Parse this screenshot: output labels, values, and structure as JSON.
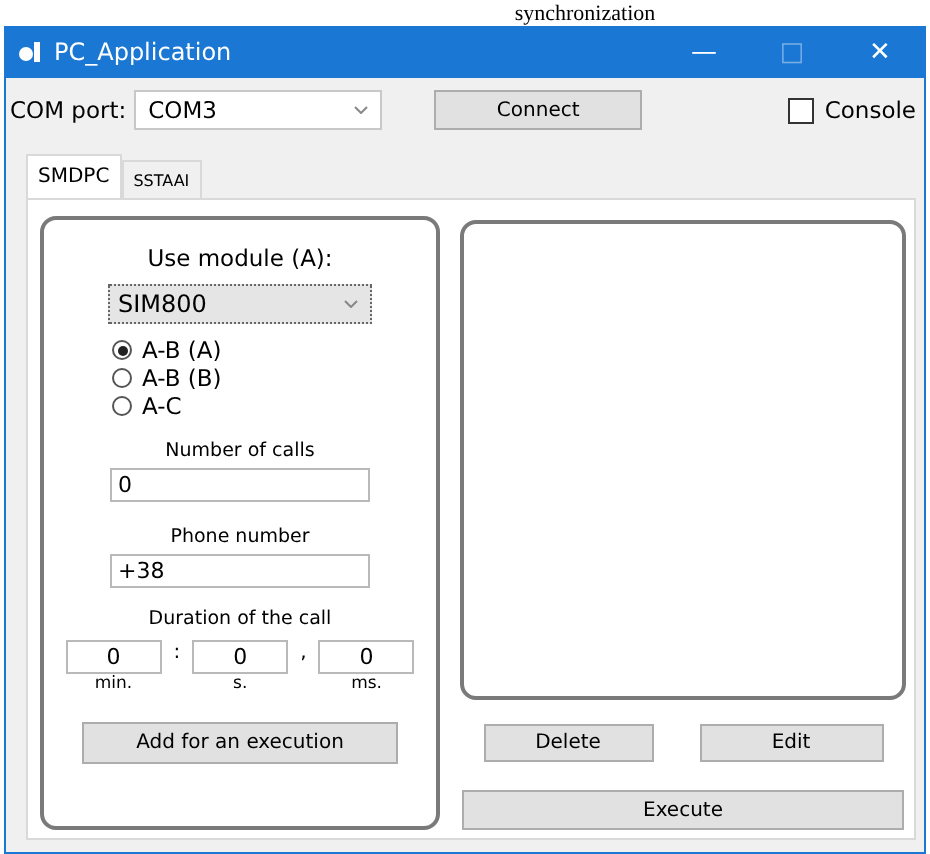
{
  "page_heading": "synchronization",
  "window": {
    "title": "PC_Application",
    "controls": [
      "—",
      "□",
      "✕"
    ]
  },
  "toolbar": {
    "port_label": "COM port:",
    "port_value": "COM3",
    "connect": "Connect",
    "console": {
      "label": "Console",
      "checked": false
    }
  },
  "tabs": [
    {
      "label": "SMDPC",
      "selected": true
    },
    {
      "label": "SSTAAI",
      "selected": false
    }
  ],
  "form": {
    "module_label": "Use module (A):",
    "module_value": "SIM800",
    "routes": [
      {
        "label": "A-B (A)",
        "selected": true
      },
      {
        "label": "A-B (B)",
        "selected": false
      },
      {
        "label": "A-C",
        "selected": false
      }
    ],
    "calls_label": "Number of calls",
    "calls_value": "0",
    "phone_label": "Phone number",
    "phone_value": "+38",
    "duration_label": "Duration of the call",
    "duration": [
      {
        "value": "0",
        "unit": "min."
      },
      {
        "value": "0",
        "unit": "s."
      },
      {
        "value": "0",
        "unit": "ms."
      }
    ],
    "separators": [
      ":",
      ","
    ],
    "add": "Add for an execution"
  },
  "actions": {
    "delete": "Delete",
    "edit": "Edit",
    "execute": "Execute"
  }
}
